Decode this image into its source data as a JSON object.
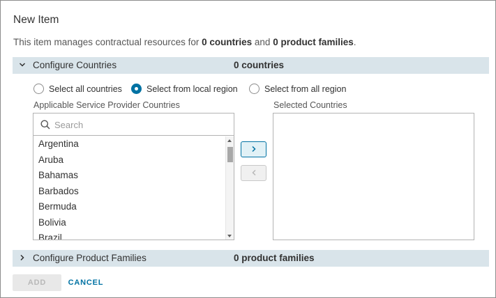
{
  "dialog": {
    "title": "New Item",
    "summary": {
      "prefix": "This item manages contractual resources for ",
      "countries": "0 countries",
      "middle": " and ",
      "families": "0 product families",
      "suffix": "."
    }
  },
  "countries_section": {
    "label": "Configure Countries",
    "count": "0 countries",
    "expanded": true,
    "radio_options": [
      {
        "label": "Select all countries",
        "checked": false
      },
      {
        "label": "Select from local region",
        "checked": true
      },
      {
        "label": "Select from all region",
        "checked": false
      }
    ],
    "available_label": "Applicable Service Provider Countries",
    "selected_label": "Selected Countries",
    "search_placeholder": "Search",
    "available_items": [
      "Argentina",
      "Aruba",
      "Bahamas",
      "Barbados",
      "Bermuda",
      "Bolivia",
      "Brazil"
    ],
    "selected_items": []
  },
  "families_section": {
    "label": "Configure Product Families",
    "count": "0 product families",
    "expanded": false
  },
  "footer": {
    "add_label": "ADD",
    "cancel_label": "CANCEL"
  },
  "icons": {
    "expand": "chevron-down-icon",
    "collapse": "chevron-right-icon",
    "search": "search-icon",
    "move_right": "chevron-right-icon",
    "move_left": "chevron-left-icon"
  },
  "colors": {
    "accent": "#0072a3",
    "section_header_bg": "#d9e4ea",
    "disabled_bg": "#e8e8e8"
  }
}
